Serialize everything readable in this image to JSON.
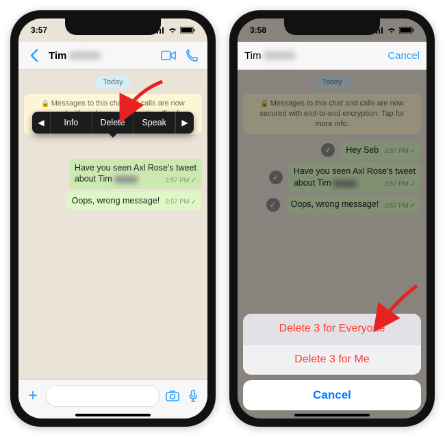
{
  "statusbar": {
    "time": "3:57",
    "time2": "3:58"
  },
  "chat": {
    "contact_name": "Tim",
    "day_label": "Today",
    "encryption_notice": "Messages to this chat and calls are now secured with end-to-end encryption. Tap for more info.",
    "cancel_label": "Cancel"
  },
  "popover": {
    "info": "Info",
    "delete": "Delete",
    "speak": "Speak"
  },
  "messages": {
    "m1": {
      "text": "Hey Seb",
      "time": "3:57 PM"
    },
    "m2a": "Have you seen Axl Rose's tweet",
    "m2b": "about Tim",
    "m2time": "3:57 PM",
    "m3": {
      "text": "Oops, wrong message!",
      "time": "3:57 PM"
    }
  },
  "actionsheet": {
    "delete_everyone": "Delete 3 for Everyone",
    "delete_me": "Delete 3 for Me",
    "cancel": "Cancel"
  }
}
